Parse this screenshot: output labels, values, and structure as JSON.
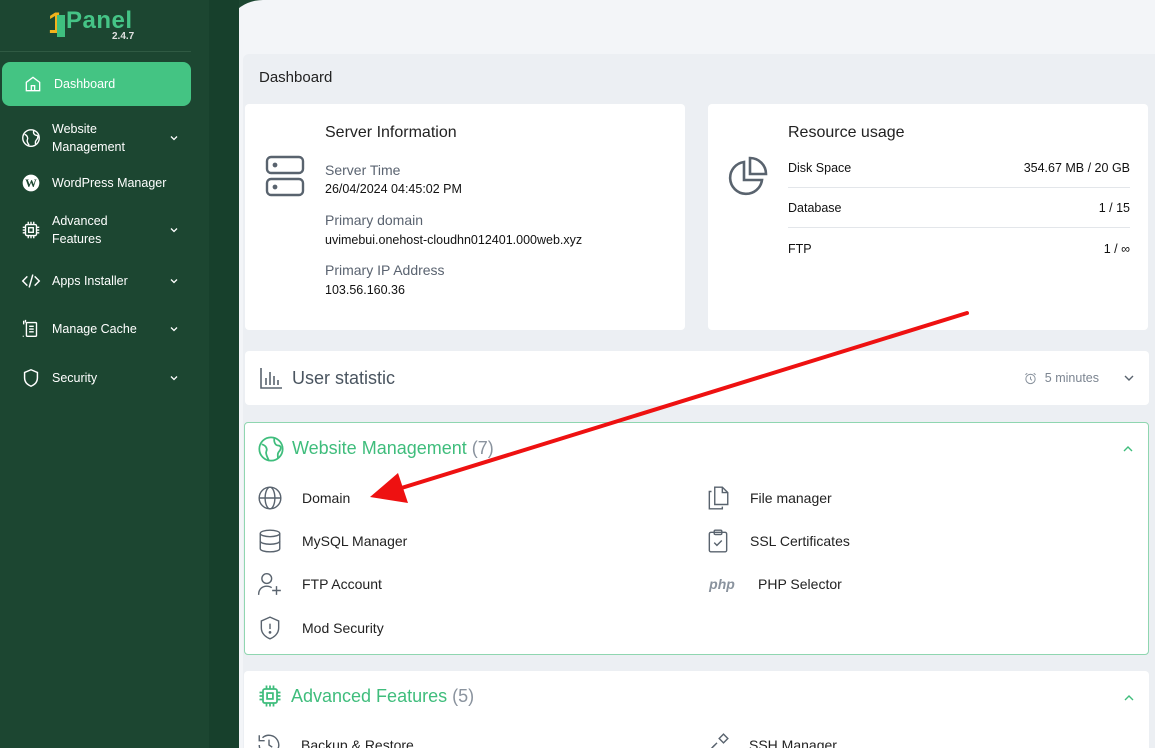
{
  "app": {
    "logo_one": "1",
    "logo_text": "Panel",
    "version": "2.4.7",
    "accent": "#44c483",
    "sidebar_bg": "#1c4631"
  },
  "sidebar": {
    "items": [
      {
        "label": "Dashboard",
        "icon": "home-icon",
        "active": true
      },
      {
        "label": "Website\nManagement",
        "icon": "globe-network-icon",
        "expandable": true
      },
      {
        "label": "WordPress Manager",
        "icon": "wordpress-icon"
      },
      {
        "label": "Advanced\nFeatures",
        "icon": "cpu-chip-icon",
        "expandable": true
      },
      {
        "label": "Apps Installer",
        "icon": "code-icon",
        "expandable": true
      },
      {
        "label": "Manage Cache",
        "icon": "cache-icon",
        "expandable": true
      },
      {
        "label": "Security",
        "icon": "shield-icon",
        "expandable": true
      }
    ]
  },
  "page": {
    "title": "Dashboard"
  },
  "server_info": {
    "title": "Server Information",
    "icon": "server-icon",
    "fields": [
      {
        "label": "Server Time",
        "value": "26/04/2024 04:45:02 PM"
      },
      {
        "label": "Primary domain",
        "value": "uvimebui.onehost-cloudhn012401.000web.xyz"
      },
      {
        "label": "Primary IP Address",
        "value": "103.56.160.36"
      }
    ]
  },
  "resource_usage": {
    "title": "Resource usage",
    "icon": "pie-chart-icon",
    "rows": [
      {
        "label": "Disk Space",
        "value": "354.67 MB / 20 GB"
      },
      {
        "label": "Database",
        "value": "1 / 15"
      },
      {
        "label": "FTP",
        "value": "1 / ∞"
      }
    ]
  },
  "user_statistic": {
    "title": "User statistic",
    "icon": "bar-chart-icon",
    "interval": "5 minutes"
  },
  "website_management": {
    "title": "Website Management",
    "count": "(7)",
    "icon": "globe-network-icon",
    "items_left": [
      {
        "label": "Domain",
        "icon": "globe-icon"
      },
      {
        "label": "MySQL Manager",
        "icon": "database-icon"
      },
      {
        "label": "FTP Account",
        "icon": "user-add-icon"
      },
      {
        "label": "Mod Security",
        "icon": "shield-alert-icon"
      }
    ],
    "items_right": [
      {
        "label": "File manager",
        "icon": "files-icon"
      },
      {
        "label": "SSL Certificates",
        "icon": "clipboard-check-icon"
      },
      {
        "label": "PHP Selector",
        "icon": "php-icon",
        "icon_text": "php"
      }
    ]
  },
  "advanced_features": {
    "title": "Advanced Features",
    "count": "(5)",
    "icon": "cpu-chip-icon",
    "items_left": [
      {
        "label": "Backup & Restore",
        "icon": "history-icon"
      }
    ],
    "items_right": [
      {
        "label": "SSH Manager",
        "icon": "ssh-icon"
      }
    ]
  },
  "annotation": {
    "color": "#ee1111"
  }
}
